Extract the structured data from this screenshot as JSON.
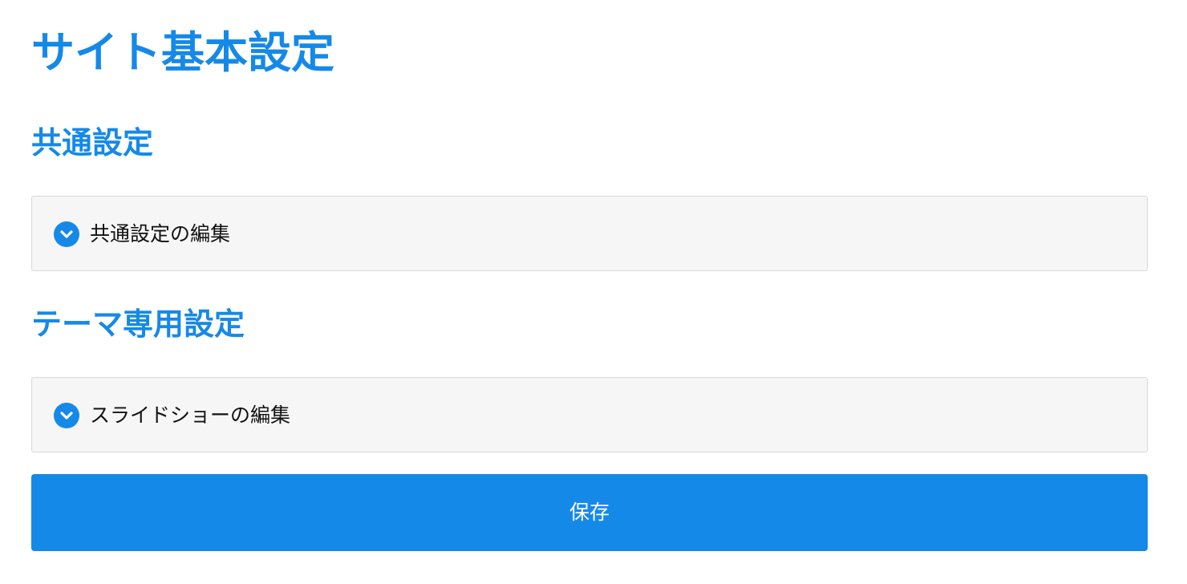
{
  "page": {
    "title": "サイト基本設定"
  },
  "sections": [
    {
      "heading": "共通設定",
      "accordion": {
        "label": "共通設定の編集",
        "icon": "chevron-down-circle-icon",
        "expanded": false
      }
    },
    {
      "heading": "テーマ専用設定",
      "accordion": {
        "label": "スライドショーの編集",
        "icon": "chevron-down-circle-icon",
        "expanded": false
      }
    }
  ],
  "actions": {
    "save_label": "保存"
  },
  "colors": {
    "accent": "#1589e8",
    "panel_background": "#f6f6f6",
    "panel_border": "#d9d9d9",
    "button_text": "#ffffff"
  }
}
